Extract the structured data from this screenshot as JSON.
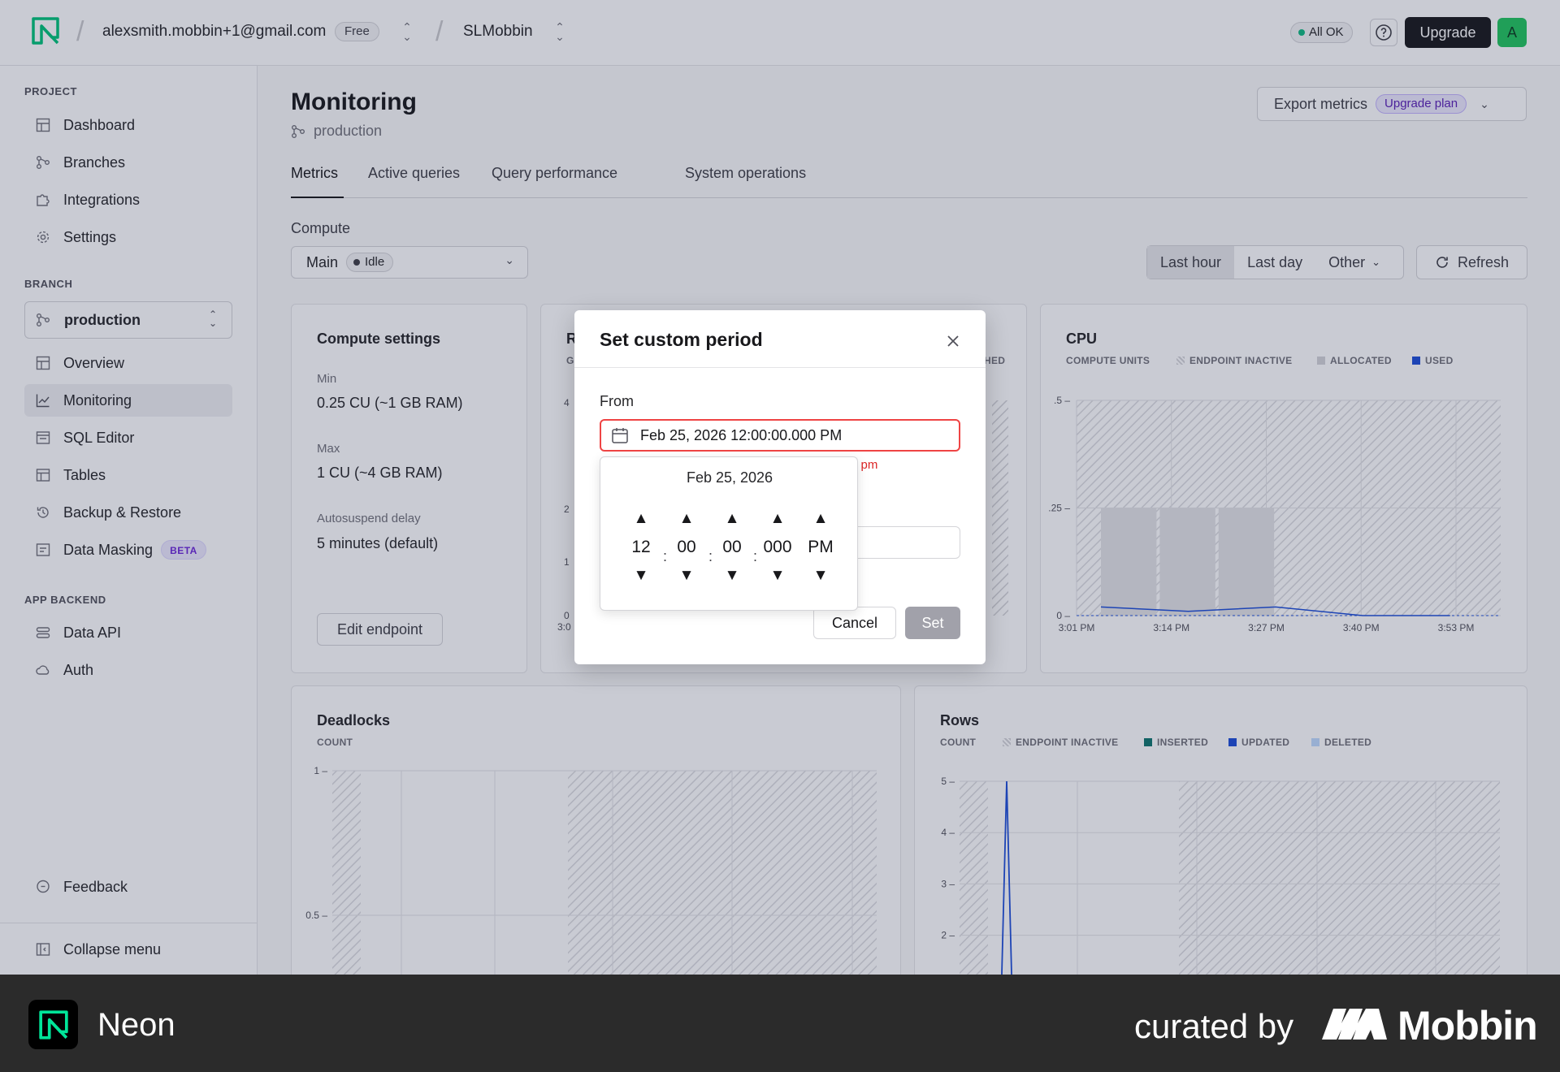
{
  "header": {
    "account_email": "alexsmith.mobbin+1@gmail.com",
    "plan_badge": "Free",
    "project_name": "SLMobbin",
    "status_label": "All OK",
    "upgrade_label": "Upgrade",
    "avatar_initial": "A"
  },
  "sidebar": {
    "project_section": "PROJECT",
    "project_items": [
      "Dashboard",
      "Branches",
      "Integrations",
      "Settings"
    ],
    "branch_section": "BRANCH",
    "branch_selected": "production",
    "branch_items": [
      "Overview",
      "Monitoring",
      "SQL Editor",
      "Tables",
      "Backup & Restore",
      "Data Masking"
    ],
    "beta_badge": "BETA",
    "app_backend_section": "APP BACKEND",
    "app_backend_items": [
      "Data API",
      "Auth"
    ],
    "feedback_label": "Feedback",
    "collapse_label": "Collapse menu"
  },
  "main": {
    "title": "Monitoring",
    "branch": "production",
    "export_label": "Export metrics",
    "upgrade_plan_label": "Upgrade plan",
    "tabs": [
      "Metrics",
      "Active queries",
      "Query performance",
      "System operations"
    ],
    "compute_label": "Compute",
    "compute_selected": "Main",
    "compute_status": "Idle",
    "periods": [
      "Last hour",
      "Last day",
      "Other"
    ],
    "refresh_label": "Refresh"
  },
  "compute_settings": {
    "title": "Compute settings",
    "min_label": "Min",
    "min_value": "0.25 CU (~1 GB RAM)",
    "max_label": "Max",
    "max_value": "1 CU (~4 GB RAM)",
    "autosuspend_label": "Autosuspend delay",
    "autosuspend_value": "5 minutes (default)",
    "edit_label": "Edit endpoint"
  },
  "ram_card": {
    "title_fragment": "R",
    "unit_fragment": "G",
    "legend_fragment": "HED",
    "x_fragment": "3:0",
    "y_ticks": [
      "4",
      "2",
      "1",
      "0"
    ]
  },
  "cpu_card": {
    "title": "CPU",
    "legend": [
      "COMPUTE UNITS",
      "ENDPOINT INACTIVE",
      "ALLOCATED",
      "USED"
    ]
  },
  "deadlocks_card": {
    "title": "Deadlocks",
    "legend": [
      "COUNT"
    ]
  },
  "rows_card": {
    "title": "Rows",
    "legend": [
      "COUNT",
      "ENDPOINT INACTIVE",
      "INSERTED",
      "UPDATED",
      "DELETED"
    ]
  },
  "chart_data": [
    {
      "type": "area",
      "title": "CPU",
      "ylabel": "COMPUTE UNITS",
      "x": [
        "3:01 PM",
        "3:14 PM",
        "3:27 PM",
        "3:40 PM",
        "3:53 PM"
      ],
      "y_ticks": [
        ".5",
        ".25",
        "0"
      ],
      "ylim": [
        0,
        0.5
      ],
      "series": [
        {
          "name": "ALLOCATED",
          "values": [
            0.25,
            0.25,
            0.25,
            0,
            0
          ]
        },
        {
          "name": "USED",
          "values": [
            0.02,
            0.01,
            0.02,
            0,
            0
          ]
        }
      ],
      "grid": true
    },
    {
      "type": "line",
      "title": "Deadlocks",
      "ylabel": "COUNT",
      "y_ticks": [
        "1",
        "0.5"
      ],
      "ylim": [
        0,
        1
      ],
      "series": [],
      "grid": true
    },
    {
      "type": "line",
      "title": "Rows",
      "ylabel": "COUNT",
      "y_ticks": [
        "5",
        "4",
        "3",
        "2",
        "1"
      ],
      "ylim": [
        0,
        5
      ],
      "series": [
        {
          "name": "UPDATED",
          "values": [
            0,
            5,
            0
          ]
        }
      ],
      "grid": true
    }
  ],
  "modal": {
    "title": "Set custom period",
    "from_label": "From",
    "from_value": "Feb 25, 2026 12:00:00.000 PM",
    "error_fragment": "l pm",
    "cancel_label": "Cancel",
    "set_label": "Set",
    "picker_date": "Feb 25, 2026",
    "time_parts": [
      "12",
      "00",
      "00",
      "000",
      "PM"
    ],
    "separators": [
      ":",
      ":",
      ":"
    ],
    "up_arrow": "▲",
    "down_arrow": "▼"
  },
  "footer": {
    "app_name": "Neon",
    "curated_by": "curated by",
    "brand": "Mobbin"
  },
  "colors": {
    "accent_dark": "#18181b",
    "status_ok": "#10b981",
    "error": "#ef4444",
    "used_series": "#1d4ed8",
    "inserted_series": "#0f766e",
    "overlay": "#1c2648"
  }
}
